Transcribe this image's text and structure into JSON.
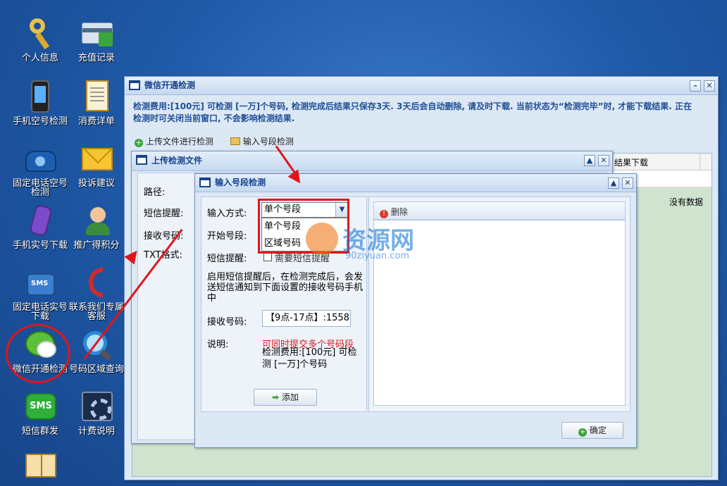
{
  "desktop": {
    "icons": [
      {
        "label": "个人信息",
        "icon": "key-icon"
      },
      {
        "label": "充值记录",
        "icon": "credit-card-icon"
      },
      {
        "label": "手机空号检测",
        "icon": "smartphone-icon"
      },
      {
        "label": "消费详单",
        "icon": "document-list-icon"
      },
      {
        "label": "固定电话空号检测",
        "icon": "telephone-icon"
      },
      {
        "label": "投诉建议",
        "icon": "envelope-icon"
      },
      {
        "label": "手机实号下载",
        "icon": "mobile-phone-icon"
      },
      {
        "label": "推广得积分",
        "icon": "person-icon"
      },
      {
        "label": "固定电话实号下载",
        "icon": "sms-phone-icon"
      },
      {
        "label": "联系我们专属客服",
        "icon": "red-phone-icon"
      },
      {
        "label": "微信开通检测",
        "icon": "wechat-icon"
      },
      {
        "label": "号码区域查询",
        "icon": "magnifier-icon"
      },
      {
        "label": "短信群发",
        "icon": "sms-icon"
      },
      {
        "label": "计费说明",
        "icon": "gear-screen-icon"
      },
      {
        "label": "",
        "icon": "book-icon"
      }
    ]
  },
  "main_window": {
    "title": "微信开通检测",
    "notice": "检测费用:[100元] 可检测 [一万]个号码, 检测完成后结果只保存3天. 3天后会自动删除, 请及时下载. 当前状态为“检测完毕”时, 才能下载结果. 正在检测时可关闭当前窗口, 不会影响检测结果.",
    "toolbar": {
      "upload_label": "上传文件进行检测",
      "input_label": "输入号段检测"
    },
    "grid": {
      "header_right": "结果下载",
      "empty_text": "没有数据"
    }
  },
  "upload_window": {
    "title": "上传检测文件",
    "labels": {
      "path": "路径:",
      "sms_remind": "短信提醒:",
      "receive": "接收号码:",
      "txt_format": "TXT格式:"
    }
  },
  "segment_window": {
    "title": "输入号段检测",
    "input_mode_label": "输入方式:",
    "input_mode_value": "单个号段",
    "dropdown_options": [
      "单个号段",
      "区域号码"
    ],
    "start_label": "开始号段:",
    "sms_label": "短信提醒:",
    "sms_checkbox_text": "需要短信提醒",
    "sms_desc": "启用短信提醒后，在检测完成后，会发送短信通知到下面设置的接收号码手机中",
    "receive_label": "接收号码:",
    "receive_value": "【9点-17点】:1558",
    "note_label": "说明:",
    "note_red": "可同时提交多个号码段",
    "note_text": "检测费用:[100元] 可检测 [一万]个号码",
    "add_button": "添加",
    "delete_button": "删除",
    "confirm_button": "确定"
  },
  "watermark": {
    "title": "资源网",
    "url": "90ziyuan.com"
  }
}
